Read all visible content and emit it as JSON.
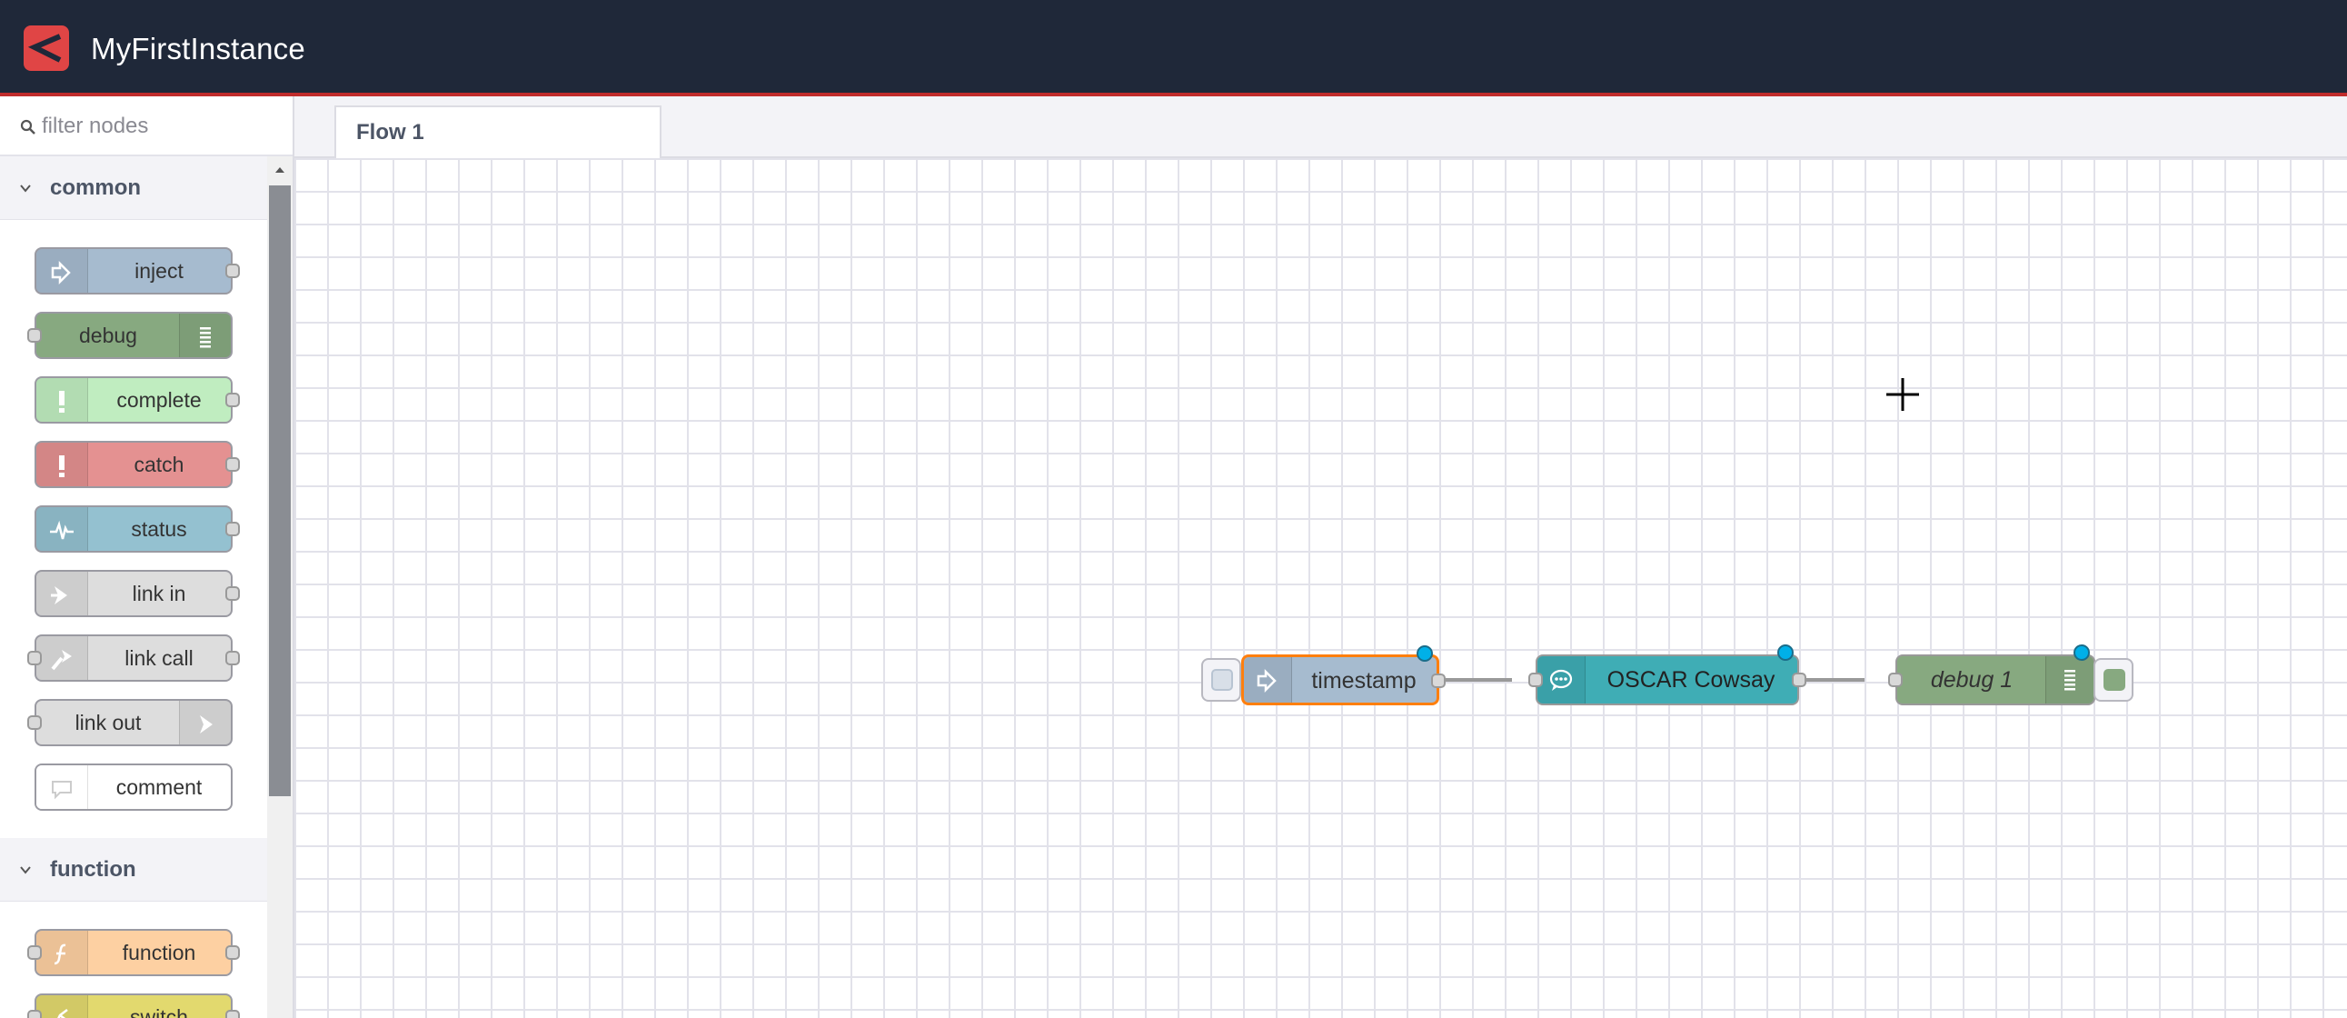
{
  "app": {
    "title": "MyFirstInstance",
    "brand_color": "#1f2839",
    "accent_color": "#c02c2c"
  },
  "palette": {
    "filter_placeholder": "filter nodes",
    "categories": [
      {
        "label": "common",
        "nodes": [
          {
            "label": "inject",
            "color": "#a6bbcf",
            "icon": "arrow-in-icon"
          },
          {
            "label": "debug",
            "color": "#87a980",
            "icon": "list-icon"
          },
          {
            "label": "complete",
            "color": "#c0edc0",
            "icon": "exclamation-icon"
          },
          {
            "label": "catch",
            "color": "#e49191",
            "icon": "exclamation-icon"
          },
          {
            "label": "status",
            "color": "#94c1d0",
            "icon": "pulse-icon"
          },
          {
            "label": "link in",
            "color": "#dddddd",
            "icon": "link-in-icon"
          },
          {
            "label": "link call",
            "color": "#dddddd",
            "icon": "link-call-icon"
          },
          {
            "label": "link out",
            "color": "#dddddd",
            "icon": "link-out-icon"
          },
          {
            "label": "comment",
            "color": "#ffffff",
            "icon": "comment-icon"
          }
        ]
      },
      {
        "label": "function",
        "nodes": [
          {
            "label": "function",
            "color": "#fdd0a2",
            "icon": "function-icon"
          },
          {
            "label": "switch",
            "color": "#e2d96e",
            "icon": "switch-icon"
          }
        ]
      }
    ]
  },
  "workspace": {
    "tabs": [
      {
        "label": "Flow 1"
      }
    ],
    "flow_nodes": [
      {
        "label": "timestamp",
        "color": "#a6bbcf",
        "icon": "arrow-in-icon",
        "selected": true,
        "changed": true
      },
      {
        "label": "OSCAR Cowsay",
        "color": "#3fadb5",
        "icon": "chat-bubble-icon",
        "selected": false,
        "changed": true
      },
      {
        "label": "debug 1",
        "color": "#87a980",
        "icon": "list-icon",
        "selected": false,
        "changed": true
      }
    ]
  }
}
